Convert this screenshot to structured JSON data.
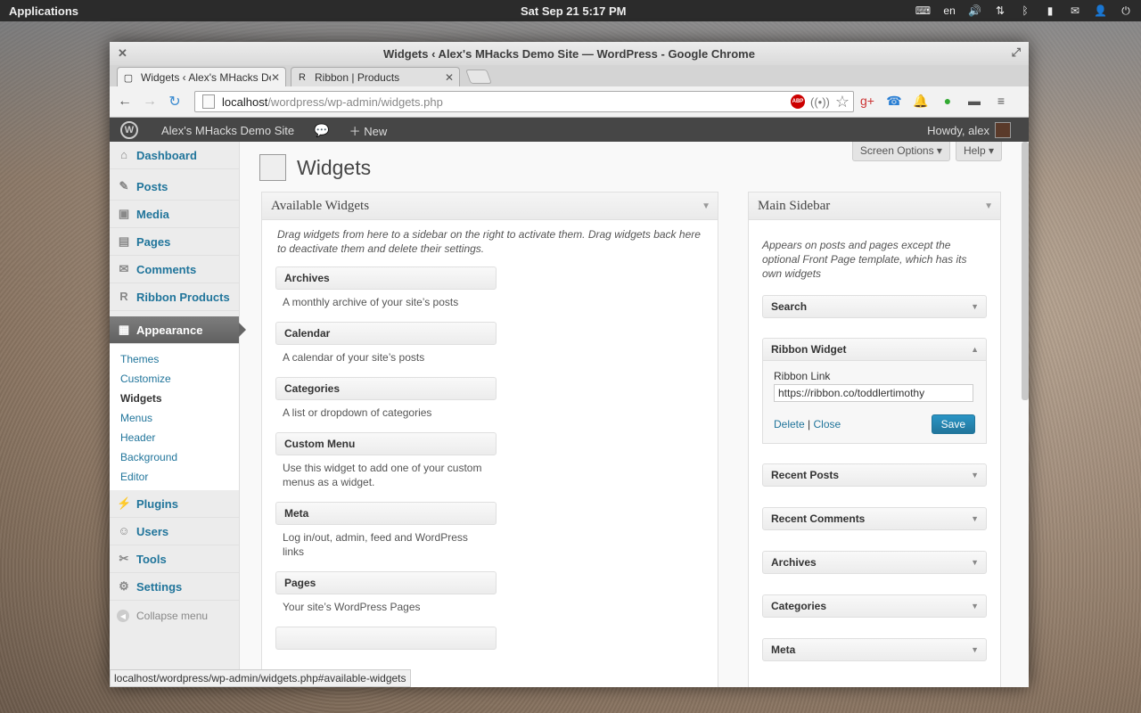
{
  "desktop": {
    "applications_label": "Applications",
    "clock": "Sat Sep 21  5:17 PM",
    "tray": {
      "lang": "en"
    }
  },
  "window": {
    "title": "Widgets ‹ Alex's MHacks Demo Site — WordPress - Google Chrome",
    "tabs": [
      {
        "label": "Widgets ‹ Alex's MHacks De",
        "active": true
      },
      {
        "label": "Ribbon | Products",
        "active": false
      }
    ],
    "url_host": "localhost",
    "url_path": "/wordpress/wp-admin/widgets.php",
    "abp_label": "ABP"
  },
  "adminbar": {
    "site_name": "Alex's MHacks Demo Site",
    "new_label": "New",
    "howdy": "Howdy, alex"
  },
  "menu": {
    "items_top": [
      {
        "label": "Dashboard",
        "icon": "home-icon"
      },
      {
        "label": "Posts",
        "icon": "pin-icon"
      },
      {
        "label": "Media",
        "icon": "media-icon"
      },
      {
        "label": "Pages",
        "icon": "pages-icon"
      },
      {
        "label": "Comments",
        "icon": "comment-icon"
      },
      {
        "label": "Ribbon Products",
        "icon": "ribbon-icon"
      }
    ],
    "appearance": "Appearance",
    "submenu": [
      "Themes",
      "Customize",
      "Widgets",
      "Menus",
      "Header",
      "Background",
      "Editor"
    ],
    "items_bottom": [
      {
        "label": "Plugins",
        "icon": "plug-icon"
      },
      {
        "label": "Users",
        "icon": "user-icon"
      },
      {
        "label": "Tools",
        "icon": "wrench-icon"
      },
      {
        "label": "Settings",
        "icon": "settings-icon"
      }
    ],
    "collapse": "Collapse menu"
  },
  "page": {
    "title": "Widgets",
    "screen_options": "Screen Options",
    "help": "Help"
  },
  "available": {
    "heading": "Available Widgets",
    "description": "Drag widgets from here to a sidebar on the right to activate them. Drag widgets back here to deactivate them and delete their settings.",
    "widgets": [
      {
        "title": "Archives",
        "desc": "A monthly archive of your site’s posts"
      },
      {
        "title": "Calendar",
        "desc": "A calendar of your site’s posts"
      },
      {
        "title": "Categories",
        "desc": "A list or dropdown of categories"
      },
      {
        "title": "Custom Menu",
        "desc": "Use this widget to add one of your custom menus as a widget."
      },
      {
        "title": "Meta",
        "desc": "Log in/out, admin, feed and WordPress links"
      },
      {
        "title": "Pages",
        "desc": "Your site’s WordPress Pages"
      }
    ]
  },
  "sidebar": {
    "heading": "Main Sidebar",
    "description": "Appears on posts and pages except the optional Front Page template, which has its own widgets",
    "search": "Search",
    "ribbon": {
      "title": "Ribbon Widget",
      "field_label": "Ribbon Link",
      "field_value": "https://ribbon.co/toddlertimothy",
      "delete": "Delete",
      "separator": "|",
      "close": "Close",
      "save": "Save"
    },
    "others": [
      "Recent Posts",
      "Recent Comments",
      "Archives",
      "Categories",
      "Meta"
    ]
  },
  "statusbar": "localhost/wordpress/wp-admin/widgets.php#available-widgets",
  "colors": {
    "link": "#21759b",
    "adminbar": "#464646",
    "save": "#21759b"
  }
}
